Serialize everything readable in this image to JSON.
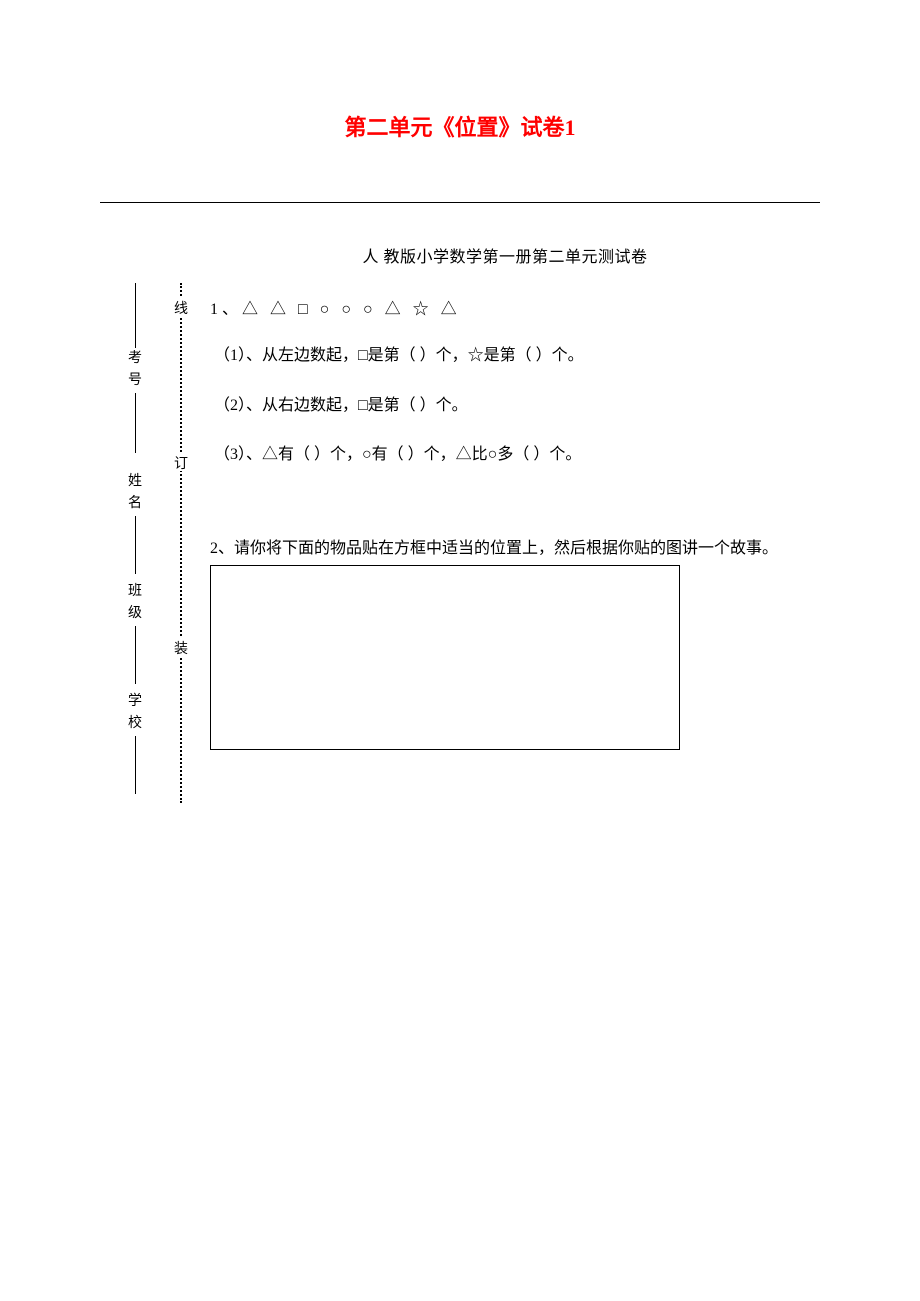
{
  "title": "第二单元《位置》试卷1",
  "subtitle": "人 教版小学数学第一册第二单元测试卷",
  "binding": {
    "school": "学校",
    "class": "班级",
    "name": "姓名",
    "exam_no": "考 号",
    "zhuang": "装",
    "ding": "订",
    "xian": "线"
  },
  "q1": {
    "num": "1、",
    "shapes": "△ △ □ ○ ○ ○ △ ☆ △",
    "sub1": "（1）、从左边数起，□是第（ ）个，☆是第（ ）个。",
    "sub2": "（2）、从右边数起，□是第（ ）个。",
    "sub3": "（3）、△有（ ）个，○有（ ）个，△比○多（ ）个。"
  },
  "q2": {
    "text": "2、请你将下面的物品贴在方框中适当的位置上，然后根据你贴的图讲一个故事。"
  }
}
